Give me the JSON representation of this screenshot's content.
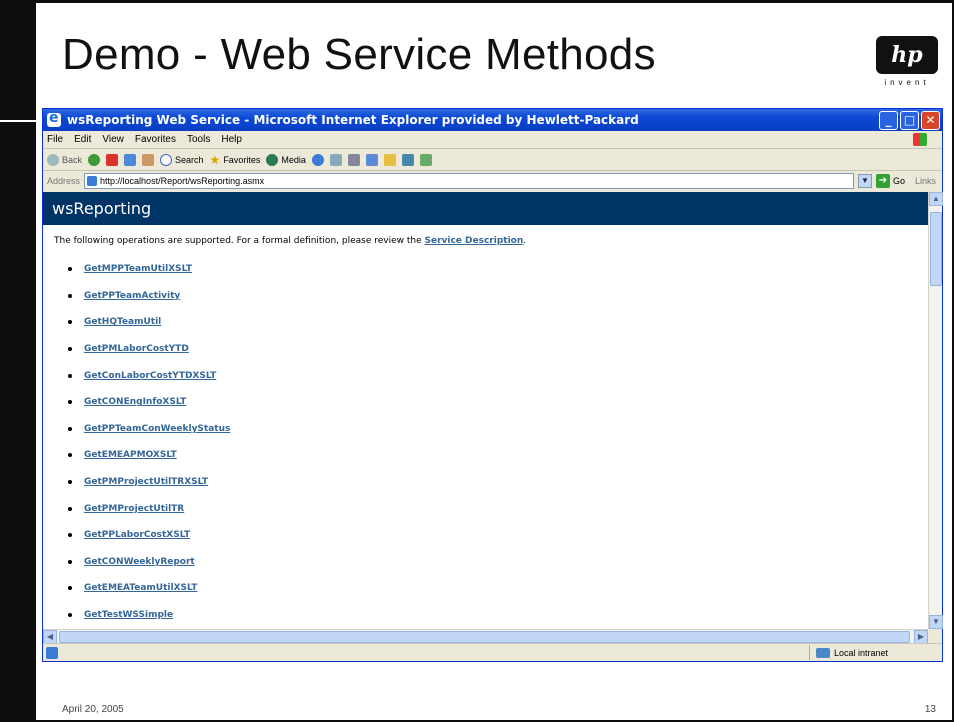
{
  "slide": {
    "title": "Demo - Web Service Methods",
    "logo_text": "hp",
    "logo_tagline": "invent",
    "footer_date": "April 20, 2005",
    "page_number": "13"
  },
  "window": {
    "title": "wsReporting Web Service - Microsoft Internet Explorer provided by Hewlett-Packard",
    "menu": [
      "File",
      "Edit",
      "View",
      "Favorites",
      "Tools",
      "Help"
    ],
    "toolbar": {
      "back_label": "Back",
      "search_label": "Search",
      "favorites_label": "Favorites",
      "media_label": "Media"
    },
    "address": {
      "label": "Address",
      "url": "http://localhost/Report/wsReporting.asmx",
      "go_label": "Go",
      "links_label": "Links"
    },
    "status": {
      "zone": "Local intranet"
    }
  },
  "page": {
    "header": "wsReporting",
    "intro_text": "The following operations are supported. For a formal definition, please review the ",
    "service_description_link": "Service Description",
    "intro_end": ".",
    "operations": [
      "GetMPPTeamUtilXSLT",
      "GetPPTeamActivity",
      "GetHQTeamUtil",
      "GetPMLaborCostYTD",
      "GetConLaborCostYTDXSLT",
      "GetCONEngInfoXSLT",
      "GetPPTeamConWeeklyStatus",
      "GetEMEAPMOXSLT",
      "GetPMProjectUtilTRXSLT",
      "GetPMProjectUtilTR",
      "GetPPLaborCostXSLT",
      "GetCONWeeklyReport",
      "GetEMEATeamUtilXSLT",
      "GetTestWSSimple"
    ]
  }
}
